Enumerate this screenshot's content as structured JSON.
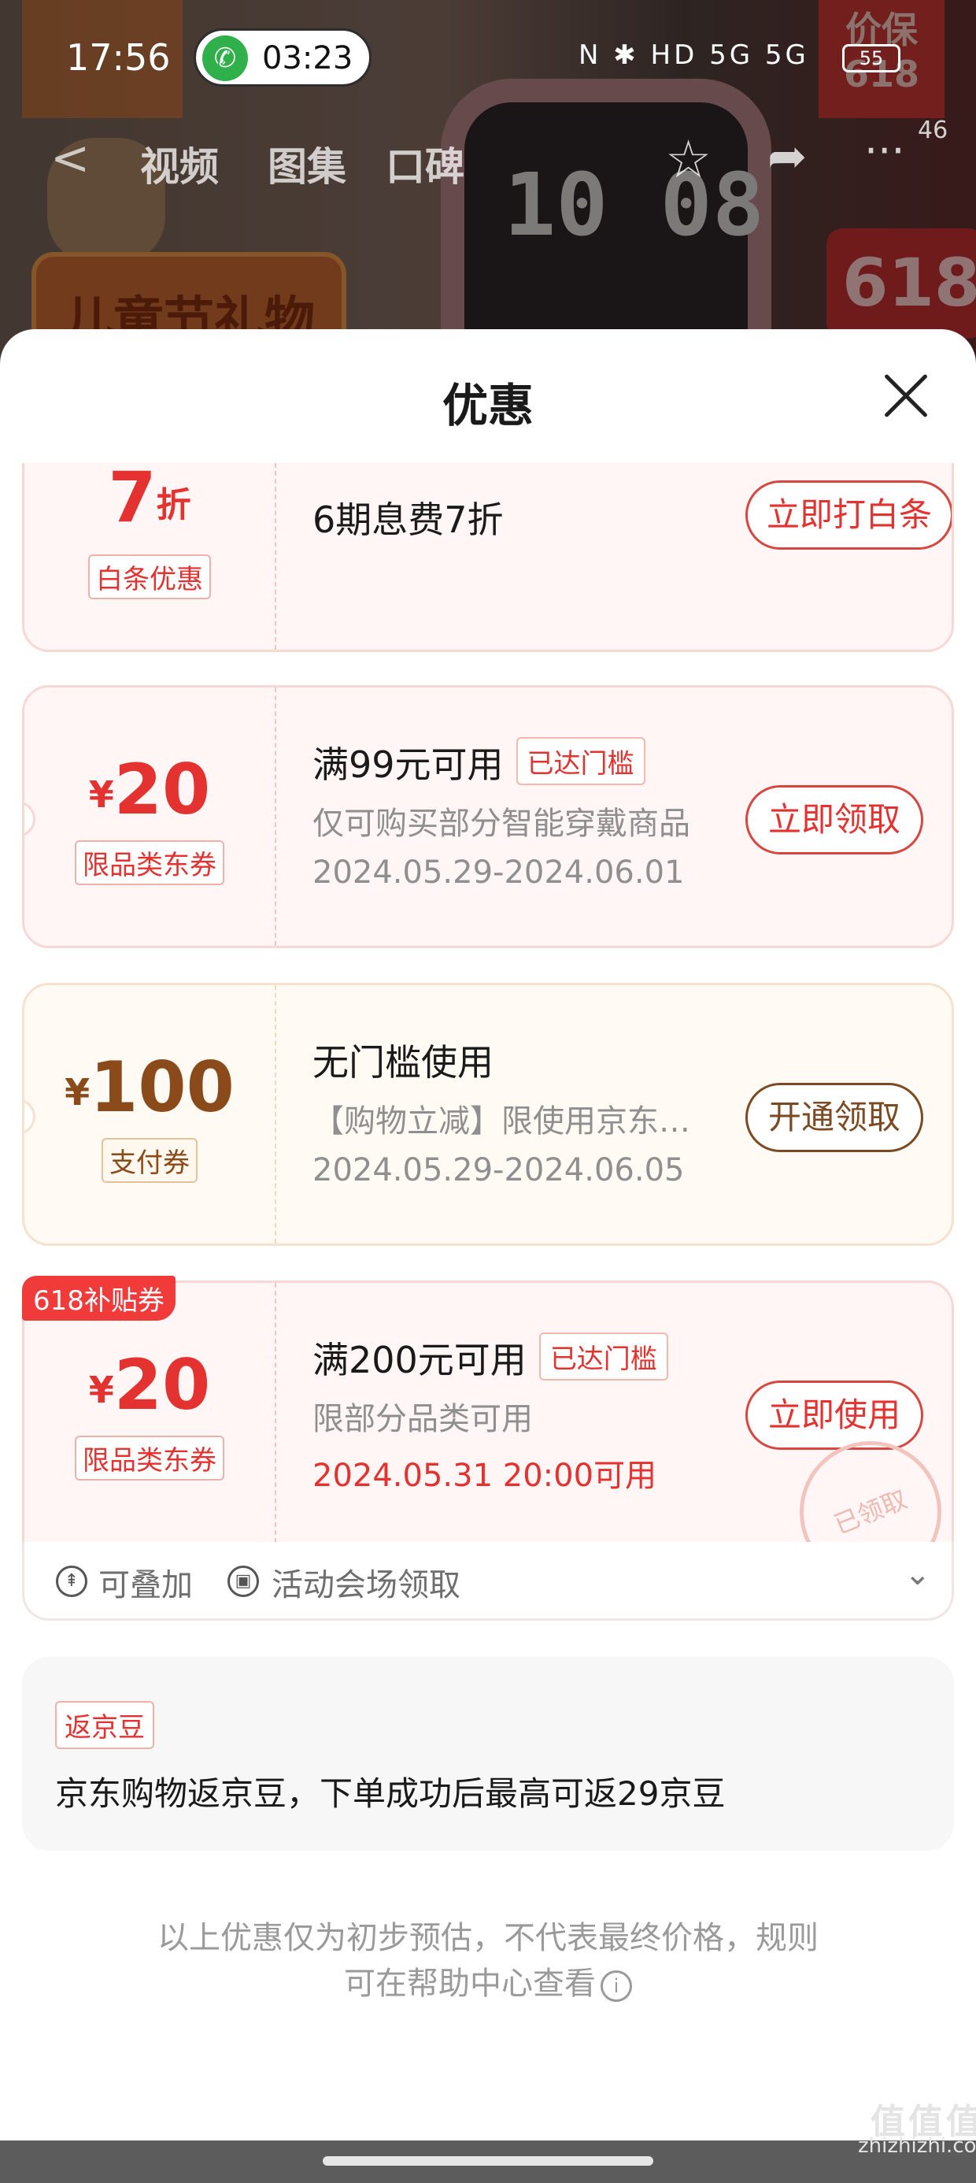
{
  "status_bar": {
    "time": "17:56",
    "call_duration": "03:23",
    "system_icons": "N ✱ HD 5G 5G",
    "battery": "55"
  },
  "product_nav": {
    "tabs": [
      "视频",
      "图集",
      "口碑"
    ],
    "more_count": "46",
    "banner_text": "儿童节礼物",
    "badge_price_protect": "价保 618",
    "badge_618": "618",
    "watch_time": "10 08"
  },
  "sheet": {
    "title": "优惠"
  },
  "offers": [
    {
      "amount": "7",
      "amount_unit": "折",
      "tag": "白条优惠",
      "condition": "6期息费7折",
      "button": "立即打白条"
    },
    {
      "currency": "¥",
      "amount": "20",
      "tag": "限品类东券",
      "condition": "满99元可用",
      "badge": "已达门槛",
      "description": "仅可购买部分智能穿戴商品",
      "date": "2024.05.29-2024.06.01",
      "button": "立即领取"
    },
    {
      "currency": "¥",
      "amount": "100",
      "tag": "支付券",
      "condition": "无门槛使用",
      "description": "【购物立减】限使用京东支付的订单可用",
      "date": "2024.05.29-2024.06.05",
      "button": "开通领取"
    },
    {
      "corner_tag": "618补贴券",
      "currency": "¥",
      "amount": "20",
      "tag": "限品类东券",
      "condition": "满200元可用",
      "badge": "已达门槛",
      "description": "限部分品类可用",
      "date": "2024.05.31 20:00可用",
      "button": "立即使用",
      "stamp": "已领取"
    }
  ],
  "offer_footer": {
    "stackable": "可叠加",
    "venue": "活动会场领取"
  },
  "jd_beans": {
    "tag": "返京豆",
    "text": "京东购物返京豆，下单成功后最高可返29京豆"
  },
  "disclaimer": {
    "line1": "以上优惠仅为初步预估，不代表最终价格，规则",
    "line2": "可在帮助中心查看"
  },
  "watermark": {
    "big": "值值值",
    "small": "zhizhizhi.com"
  }
}
